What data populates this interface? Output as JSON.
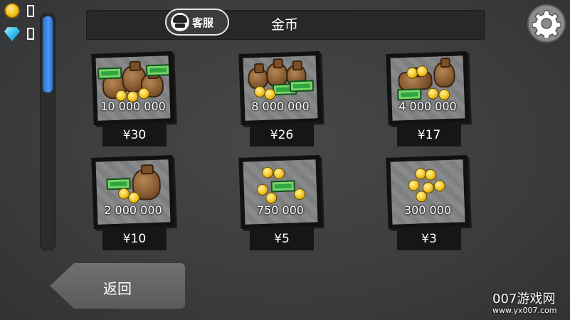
{
  "currency": {
    "coins_value": "",
    "gems_value": ""
  },
  "scrollbar": {
    "position": 0.0,
    "visible_fraction": 0.33
  },
  "header": {
    "title": "金币",
    "service_button_label": "客服"
  },
  "shop": {
    "items": [
      {
        "amount": "10 000 000",
        "price": "¥30"
      },
      {
        "amount": "8 000 000",
        "price": "¥26"
      },
      {
        "amount": "4 000 000",
        "price": "¥17"
      },
      {
        "amount": "2 000 000",
        "price": "¥10"
      },
      {
        "amount": "750 000",
        "price": "¥5"
      },
      {
        "amount": "300 000",
        "price": "¥3"
      }
    ]
  },
  "back_button_label": "返回",
  "watermark": {
    "logo": "007游戏网",
    "url": "www.yx007.com"
  },
  "icons": [
    "coin-icon",
    "gem-icon",
    "customer-service-icon",
    "gear-icon",
    "back-arrow-icon"
  ],
  "colors": {
    "background": "#3d3f41",
    "header_bar": "#262829",
    "scroll_thumb": "#4a9af0",
    "price_tag": "#151616"
  }
}
